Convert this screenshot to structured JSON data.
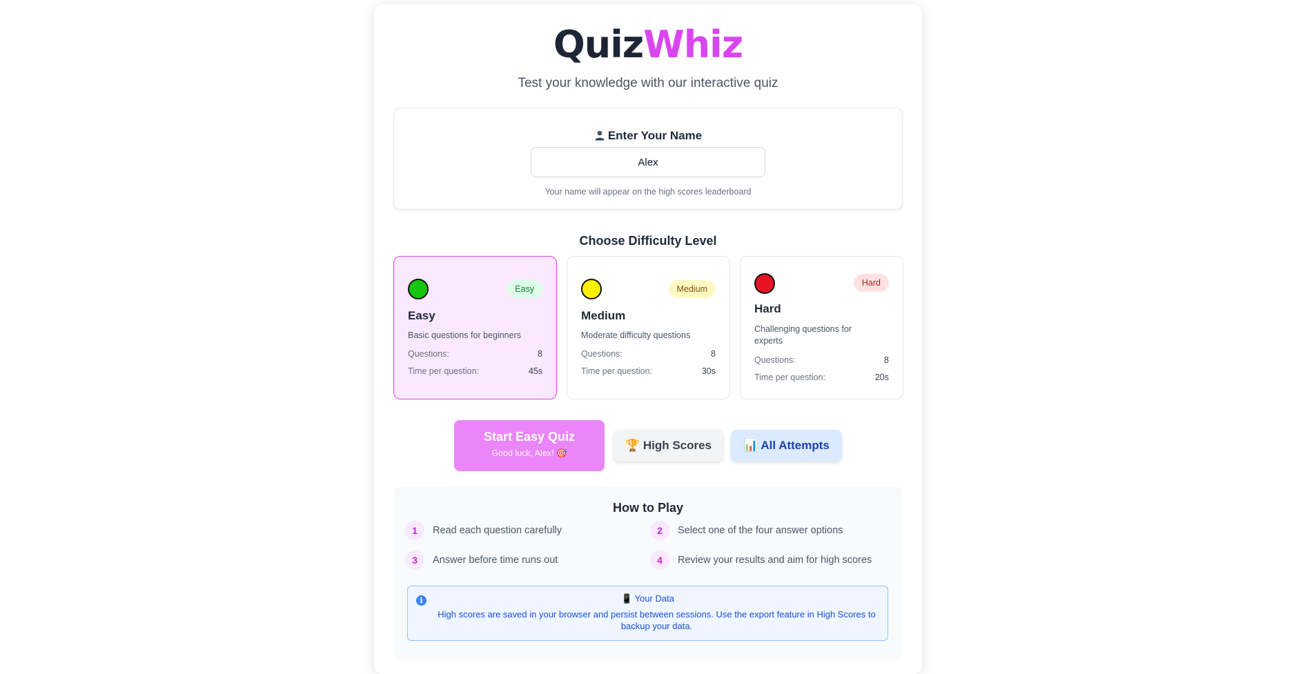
{
  "app": {
    "logo_part1": "Quiz",
    "logo_part2": "Whiz",
    "subtitle": "Test your knowledge with our interactive quiz"
  },
  "name_section": {
    "icon": "user-icon",
    "title": "Enter Your Name",
    "input_value": "Alex",
    "hint": "Your name will appear on the high scores leaderboard"
  },
  "difficulty": {
    "title": "Choose Difficulty Level",
    "selected": "Easy",
    "levels": [
      {
        "name": "Easy",
        "badge": "Easy",
        "dot_color": "#16c60c",
        "badge_bg": "#dcfce7",
        "badge_color": "#15803d",
        "description": "Basic questions for beginners",
        "questions_label": "Questions:",
        "questions": "8",
        "time_label": "Time per question:",
        "time": "45s"
      },
      {
        "name": "Medium",
        "badge": "Medium",
        "dot_color": "#fff100",
        "badge_bg": "#fef9c3",
        "badge_color": "#854d0e",
        "description": "Moderate difficulty questions",
        "questions_label": "Questions:",
        "questions": "8",
        "time_label": "Time per question:",
        "time": "30s"
      },
      {
        "name": "Hard",
        "badge": "Hard",
        "dot_color": "#e81224",
        "badge_bg": "#fee2e2",
        "badge_color": "#b91c1c",
        "description": "Challenging questions for experts",
        "questions_label": "Questions:",
        "questions": "8",
        "time_label": "Time per question:",
        "time": "20s"
      }
    ]
  },
  "actions": {
    "start_label": "Start Easy Quiz",
    "start_sub": "Good luck, Alex! 🎯",
    "high_scores_label": "🏆 High Scores",
    "all_attempts_label": "📊 All Attempts"
  },
  "how_to_play": {
    "title": "How to Play",
    "steps": [
      {
        "num": "1",
        "text": "Read each question carefully"
      },
      {
        "num": "2",
        "text": "Select one of the four answer options"
      },
      {
        "num": "3",
        "text": "Answer before time runs out"
      },
      {
        "num": "4",
        "text": "Review your results and aim for high scores"
      }
    ],
    "data_title": "📱 Your Data",
    "data_text": "High scores are saved in your browser and persist between sessions. Use the export feature in High Scores to backup your data.",
    "info_icon": "info-icon"
  },
  "colors": {
    "accent": "#d946ef",
    "dark": "#1e2535"
  }
}
